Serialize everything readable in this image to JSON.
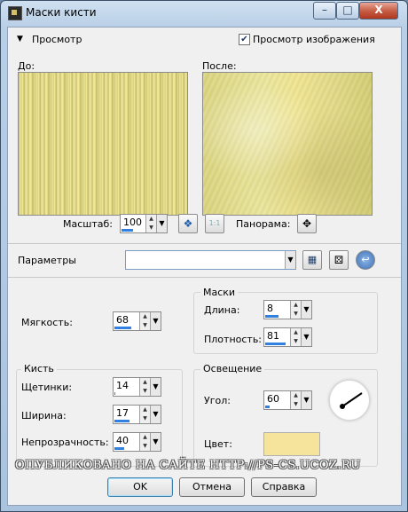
{
  "window": {
    "title": "Маски кисти",
    "minimize": "–",
    "maximize": "□",
    "close": "X"
  },
  "preview": {
    "section_label": "Просмотр",
    "show_preview_label": "Просмотр изображения",
    "show_preview_checked": true,
    "before_label": "До:",
    "after_label": "После:",
    "zoom_label": "Масштаб:",
    "zoom_value": "100",
    "zoom_fraction": 0.5,
    "pan_label": "Панорама:"
  },
  "params": {
    "label": "Параметры",
    "preset_value": ""
  },
  "softness": {
    "label": "Мягкость:",
    "value": "68",
    "fraction": 0.68
  },
  "masks": {
    "group_label": "Маски",
    "length_label": "Длина:",
    "length_value": "8",
    "length_fraction": 0.55,
    "density_label": "Плотность:",
    "density_value": "81",
    "density_fraction": 0.81
  },
  "brush": {
    "group_label": "Кисть",
    "bristles_label": "Щетинки:",
    "bristles_value": "14",
    "bristles_fraction": 0.05,
    "width_label": "Ширина:",
    "width_value": "17",
    "width_fraction": 0.6,
    "opacity_label": "Непрозрачность:",
    "opacity_value": "40",
    "opacity_fraction": 0.4
  },
  "lighting": {
    "group_label": "Освещение",
    "angle_label": "Угол:",
    "angle_value": "60",
    "angle_fraction": 0.17,
    "color_label": "Цвет:",
    "color_hex": "#f6e39c"
  },
  "watermark": "ОПУБЛИКОВАНО НА САЙТЕ HTTP://PS-CS.UCOZ.RU",
  "buttons": {
    "ok": "OK",
    "cancel": "Отмена",
    "help": "Справка"
  },
  "colors": {
    "accent": "#2f80e0"
  }
}
